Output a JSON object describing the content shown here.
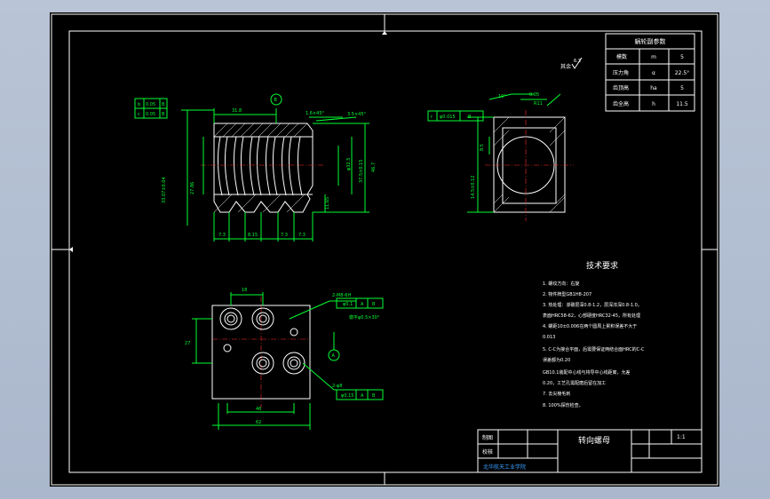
{
  "params_table": {
    "title": "蜗轮副参数",
    "rows": [
      {
        "name": "模数",
        "symbol": "m",
        "value": "5"
      },
      {
        "name": "压力角",
        "symbol": "α",
        "value": "22.5°"
      },
      {
        "name": "齿顶高",
        "symbol": "ha",
        "value": "5"
      },
      {
        "name": "齿全高",
        "symbol": "h",
        "value": "11.5"
      }
    ]
  },
  "roughness_note": "其余",
  "roughness_value": "6.3",
  "tech_req": {
    "title": "技术要求",
    "lines": [
      "1. 螺纹方向：右旋",
      "2. 物件牌型GB1H8-207",
      "3. 热处理：渗碳层深0.8-1.2，层深淬深0.8-1.0。",
      "表面HRC58-62，心部硬度HRC32-45，所有处理",
      "4. 螺距10±0.006在两个圆周上累积误差不大于",
      "0.013",
      "5. C-C为接合平面，后需要保证两结合面HRC的C-C",
      "误差都为0.20",
      "GB10.1装配中心线与将导中心线距离，允差",
      "0.20，工艺孔需配磨后留在加工",
      "7. 去尖棱毛刺",
      "8. 100%探伤检查。"
    ]
  },
  "title_block": {
    "drawn_label": "制图",
    "checked_label": "校核",
    "part_name": "转向螺母",
    "scale": "1:1",
    "school": "北华航天工业学院"
  },
  "front_view": {
    "dims": [
      "31.8",
      "1.6×45°",
      "3.5×45°",
      "φ32.5",
      "37.5±0.15",
      "46.7",
      "33.07±0.04",
      "27.86",
      "11.65",
      "7.3",
      "8.15",
      "7.3",
      "7.3"
    ],
    "datum": "B",
    "tol_frame": [
      {
        "sym": "b",
        "val": "0.05",
        "ref": "B"
      },
      {
        "sym": "c",
        "val": "0.05",
        "ref": "B"
      }
    ]
  },
  "side_view": {
    "dims": [
      "10°",
      "0.05",
      "R11",
      "8.5",
      "14.5±0.12"
    ],
    "tol_frame": {
      "sym": "r",
      "val": "φ0.015",
      "ref": "B"
    }
  },
  "bottom_view": {
    "dims": [
      "18",
      "46",
      "62",
      "27",
      "2-M8-6H",
      "锪平φ0.5×30°",
      "2-φ8"
    ],
    "tol_frame_1": {
      "val": "φ0.1",
      "ref": "A",
      "ref2": "B"
    },
    "tol_frame_2": {
      "val": "φ0.15",
      "ref": "A",
      "ref2": "B"
    },
    "datum": "A"
  }
}
